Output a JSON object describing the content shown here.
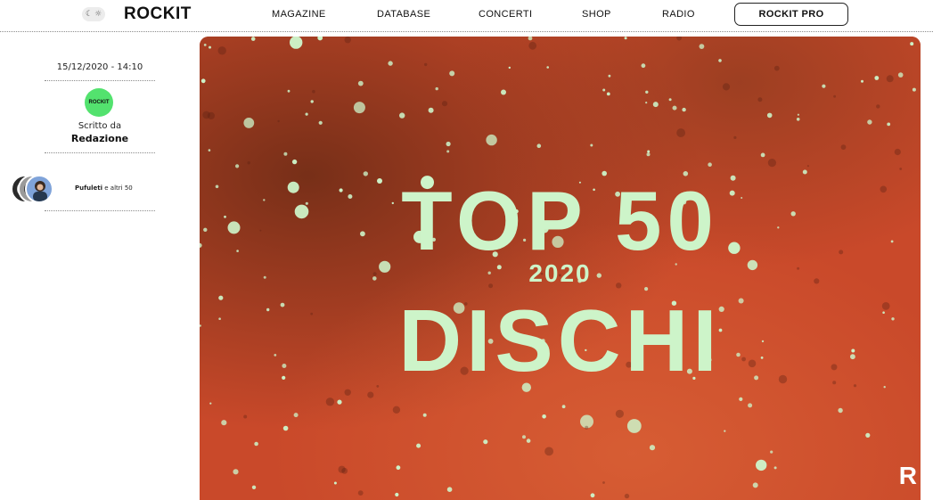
{
  "header": {
    "theme_toggle": {
      "moon": "☾",
      "sun": "☼"
    },
    "logo": "ROCKIT",
    "nav": [
      "MAGAZINE",
      "DATABASE",
      "CONCERTI",
      "SHOP",
      "RADIO"
    ],
    "pro_label": "ROCKIT PRO"
  },
  "sidebar": {
    "date": "15/12/2020 - 14:10",
    "author_avatar_text": "ROCKIT",
    "written_by": "Scritto da",
    "author": "Redazione",
    "likers": {
      "name": "Pufuleti",
      "rest": " e altri 50"
    }
  },
  "hero": {
    "line1": "TOP 50",
    "line2": "2020",
    "line3": "DISCHI",
    "corner_mark": "R"
  },
  "colors": {
    "hero_text": "#cdf4c9",
    "hero_background": "#c4461f",
    "author_avatar": "#53e26e"
  }
}
